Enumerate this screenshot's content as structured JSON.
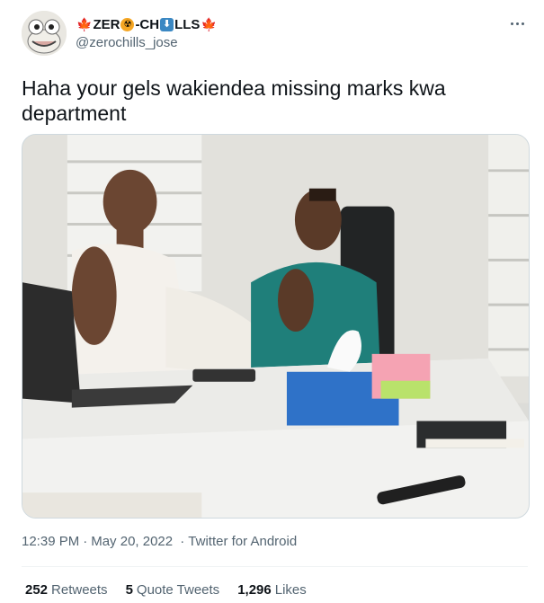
{
  "author": {
    "display_name_parts": {
      "flag_left": "🍁",
      "part1": "ZER",
      "emoji1": "☢",
      "part2": "-CH",
      "emoji2": "⬇",
      "part3": "LLS",
      "flag_right": "🍁"
    },
    "handle": "@zerochills_jose",
    "avatar_icon": "frog-avatar-icon"
  },
  "more_icon": "more-dots-icon",
  "tweet": {
    "text": "Haha your gels wakiendea missing marks kwa department"
  },
  "media": {
    "icon": "photo-office-scene"
  },
  "meta": {
    "time": "12:39 PM",
    "date": "May 20, 2022",
    "source": "Twitter for Android"
  },
  "stats": {
    "retweets_count": "252",
    "retweets_label": "Retweets",
    "quotes_count": "5",
    "quotes_label": "Quote Tweets",
    "likes_count": "1,296",
    "likes_label": "Likes"
  },
  "colors": {
    "text_primary": "#0f1419",
    "text_secondary": "#536471",
    "divider": "#eff3f4",
    "flag_red": "#d52b1e"
  }
}
